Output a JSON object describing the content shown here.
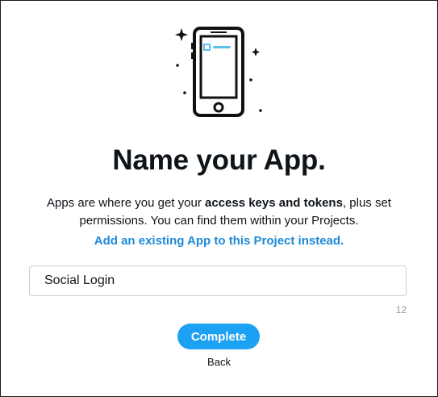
{
  "dialog": {
    "title": "Name your App.",
    "description_before": "Apps are where you get your ",
    "description_bold": "access keys and tokens",
    "description_after": ", plus set permissions. You can find them within your Projects.",
    "existing_app_link": "Add an existing App to this Project instead.",
    "app_name_value": "Social Login",
    "char_counter": "12",
    "complete_label": "Complete",
    "back_label": "Back"
  },
  "colors": {
    "primary": "#1da1f2",
    "link": "#1d8ad6",
    "text": "#0f1419",
    "muted": "#8b98a5",
    "illustration_accent": "#5bc0eb"
  },
  "icons": {
    "illustration": "phone-illustration",
    "sparkles": "sparkle-icon"
  }
}
